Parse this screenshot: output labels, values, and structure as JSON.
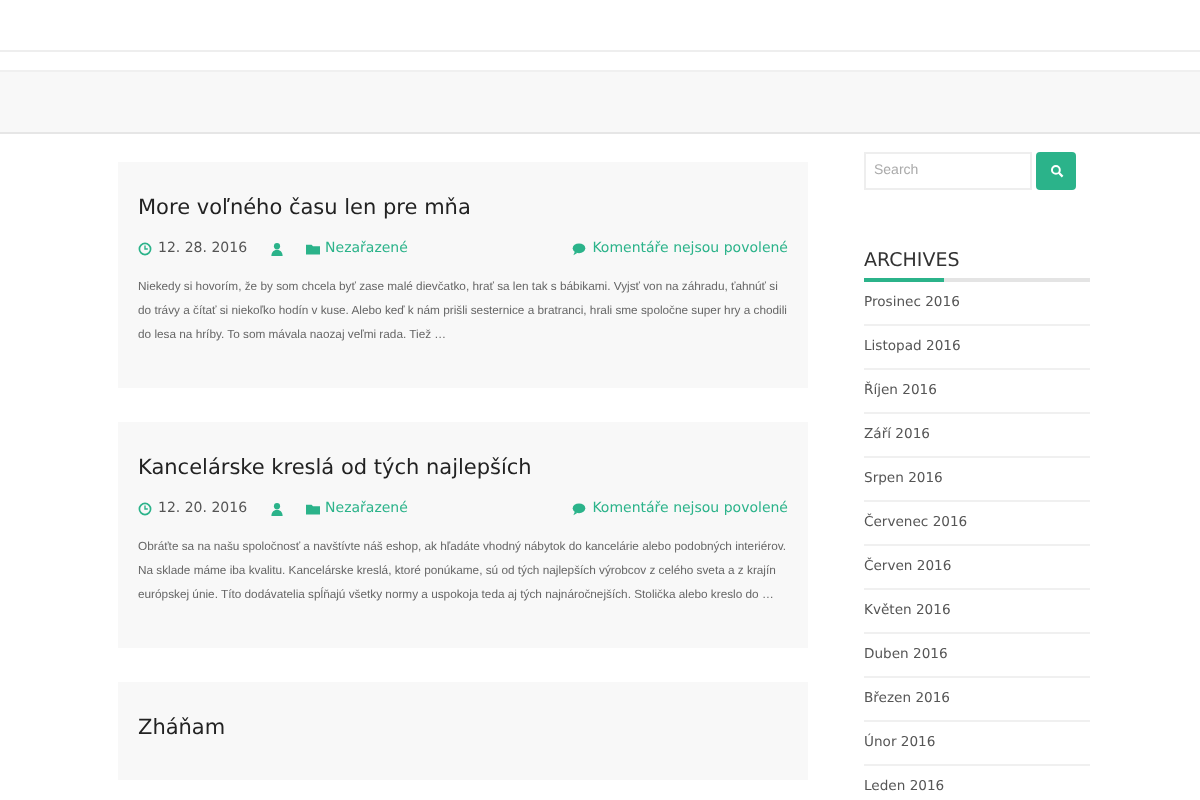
{
  "search": {
    "placeholder": "Search"
  },
  "posts": [
    {
      "title": "More voľného času len pre mňa",
      "date": "12. 28. 2016",
      "category": "Nezařazené",
      "comments": "Komentáře nejsou povolené",
      "excerpt": "Niekedy si hovorím, že by som chcela byť zase malé dievčatko, hrať sa len tak s bábikami. Vyjsť von na záhradu, ťahnúť si do trávy a čítať si niekoľko hodín v kuse. Alebo keď k nám prišli sesternice a bratranci,  hrali sme spoločne super hry a chodili do lesa na hríby. To som mávala naozaj veľmi rada. Tiež …"
    },
    {
      "title": "Kancelárske kreslá od tých najlepších",
      "date": "12. 20. 2016",
      "category": "Nezařazené",
      "comments": "Komentáře nejsou povolené",
      "excerpt": "Obráťte sa na našu spoločnosť a navštívte náš eshop, ak hľadáte vhodný nábytok do kancelárie alebo podobných interiérov. Na sklade máme iba kvalitu. Kancelárske kreslá, ktoré ponúkame, sú od tých najlepších výrobcov z celého sveta a z krajín európskej únie. Títo dodávatelia spĺňajú všetky normy a uspokoja teda aj tých najnáročnejších. Stolička alebo kreslo do …"
    },
    {
      "title": "Zháňam"
    }
  ],
  "archives": {
    "title": "ARCHIVES",
    "items": [
      "Prosinec 2016",
      "Listopad 2016",
      "Říjen 2016",
      "Září 2016",
      "Srpen 2016",
      "Červenec 2016",
      "Červen 2016",
      "Květen 2016",
      "Duben 2016",
      "Březen 2016",
      "Únor 2016",
      "Leden 2016"
    ]
  }
}
